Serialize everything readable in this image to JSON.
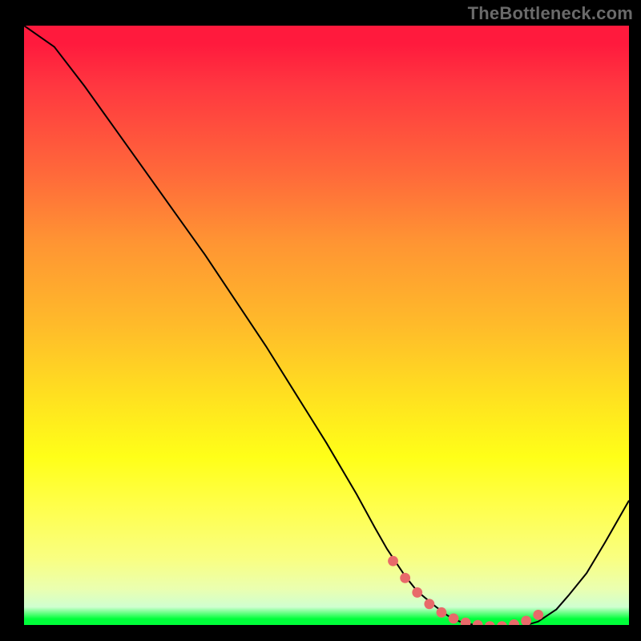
{
  "watermark": "TheBottleneck.com",
  "chart_data": {
    "type": "line",
    "title": "",
    "xlabel": "",
    "ylabel": "",
    "xlim": [
      0,
      100
    ],
    "ylim": [
      0,
      100
    ],
    "series": [
      {
        "name": "bottleneck-curve",
        "x": [
          0,
          5,
          10,
          15,
          20,
          25,
          30,
          35,
          40,
          45,
          50,
          55,
          58,
          60,
          63,
          65,
          68,
          70,
          72,
          75,
          78,
          80,
          82,
          85,
          88,
          90,
          93,
          96,
          100
        ],
        "y": [
          100,
          96.5,
          90,
          83,
          76,
          69,
          62,
          54.5,
          47,
          39,
          31,
          22.5,
          17,
          13.5,
          9,
          6.5,
          4,
          2.5,
          1.5,
          0.8,
          0.4,
          0.4,
          0.6,
          1.5,
          3.5,
          5.8,
          9.5,
          14.5,
          21.5
        ]
      }
    ],
    "markers": {
      "name": "highlight-band",
      "color": "#e86a6a",
      "x": [
        61,
        63,
        65,
        67,
        69,
        71,
        73,
        75,
        77,
        79,
        81,
        83,
        85
      ],
      "y": [
        11.5,
        8.7,
        6.3,
        4.4,
        3.0,
        2.0,
        1.3,
        0.9,
        0.7,
        0.7,
        1.0,
        1.6,
        2.6
      ]
    }
  }
}
